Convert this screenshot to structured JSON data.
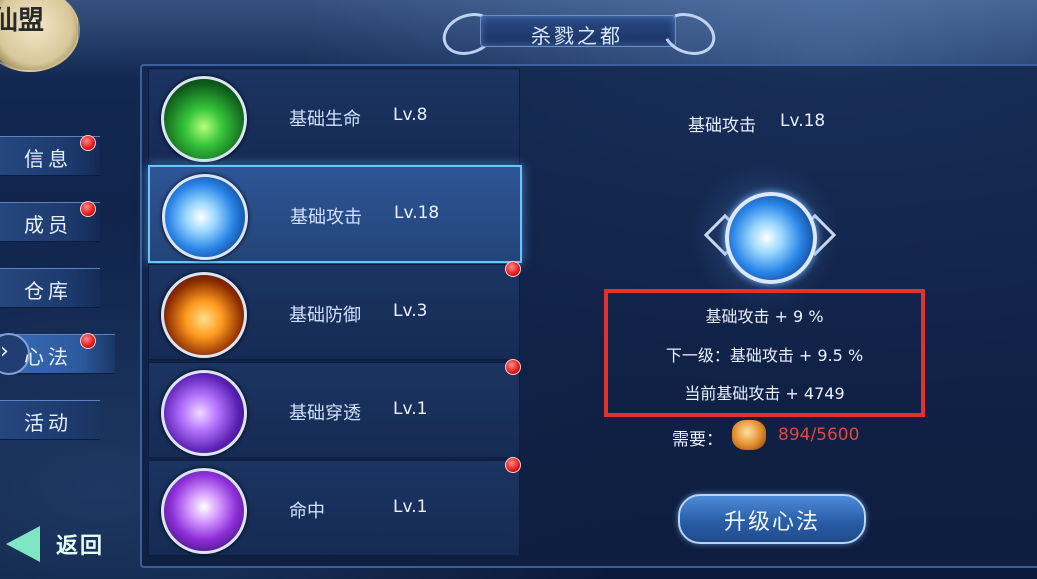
{
  "header": {
    "title": "杀戮之都"
  },
  "guild_emblem": {
    "text": "仙盟"
  },
  "side_nav": {
    "items": [
      {
        "label": "信息",
        "badge": true
      },
      {
        "label": "成员",
        "badge": true
      },
      {
        "label": "仓库",
        "badge": false
      },
      {
        "label": "心法",
        "badge": true,
        "active": true
      },
      {
        "label": "活动",
        "badge": false
      }
    ],
    "back_label": "返回"
  },
  "skills": [
    {
      "name": "基础生命",
      "level": "Lv.8",
      "icon": "green-life-icon",
      "badge": false,
      "selected": false
    },
    {
      "name": "基础攻击",
      "level": "Lv.18",
      "icon": "blue-crystal-icon",
      "badge": false,
      "selected": true
    },
    {
      "name": "基础防御",
      "level": "Lv.3",
      "icon": "fire-shield-icon",
      "badge": true,
      "selected": false
    },
    {
      "name": "基础穿透",
      "level": "Lv.1",
      "icon": "purple-shard-icon",
      "badge": true,
      "selected": false
    },
    {
      "name": "命中",
      "level": "Lv.1",
      "icon": "violet-orb-icon",
      "badge": true,
      "selected": false
    }
  ],
  "detail": {
    "title": "基础攻击",
    "level": "Lv.18",
    "current": "基础攻击 + 9 %",
    "next": "下一级：基础攻击 + 9.5 %",
    "total": "当前基础攻击 + 4749",
    "need_label": "需要：",
    "need_value": "894/5600",
    "upgrade_label": "升级心法"
  },
  "colors": {
    "highlight_box": "#e2312f",
    "cost_text": "#e0473f",
    "selected_border": "#6bc4ff"
  }
}
